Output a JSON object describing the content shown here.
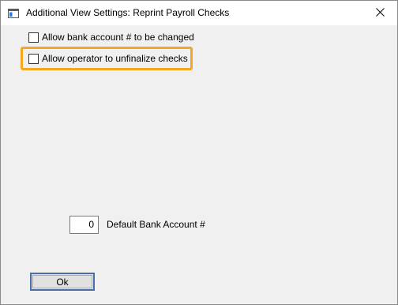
{
  "window": {
    "title": "Additional View Settings: Reprint Payroll Checks"
  },
  "options": {
    "allow_bank_account_change": {
      "label": "Allow bank account # to be changed",
      "checked": false
    },
    "allow_unfinalize": {
      "label": "Allow operator to unfinalize checks",
      "checked": false
    }
  },
  "default_bank_account": {
    "value": "0",
    "label": "Default Bank Account #"
  },
  "buttons": {
    "ok_label": "Ok"
  },
  "colors": {
    "highlight": "#f5a623",
    "ok_border": "#4a6fa5",
    "window_bg": "#f0f0f0"
  },
  "icons": {
    "app": "window-app-icon",
    "close": "close-icon"
  }
}
